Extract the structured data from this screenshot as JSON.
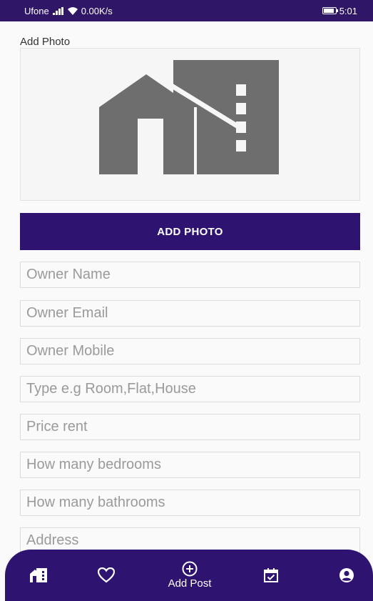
{
  "status_bar": {
    "left_text": "Ufone",
    "network": "0.00K/s",
    "time": "5:01"
  },
  "photo_section": {
    "label": "Add Photo",
    "button_label": "ADD PHOTO",
    "placeholder_icon": "house-icon"
  },
  "form": {
    "owner_name": {
      "value": "",
      "placeholder": "Owner Name"
    },
    "owner_email": {
      "value": "",
      "placeholder": "Owner Email"
    },
    "owner_mobile": {
      "value": "",
      "placeholder": "Owner Mobile"
    },
    "type": {
      "value": "",
      "placeholder": "Type e.g Room,Flat,House"
    },
    "price_rent": {
      "value": "",
      "placeholder": "Price rent"
    },
    "bedrooms": {
      "value": "",
      "placeholder": "How many bedrooms"
    },
    "bathrooms": {
      "value": "",
      "placeholder": "How many bathrooms"
    },
    "address": {
      "value": "",
      "placeholder": "Address"
    }
  },
  "bottom_nav": {
    "items": [
      {
        "icon": "home-icon",
        "label": ""
      },
      {
        "icon": "heart-icon",
        "label": ""
      },
      {
        "icon": "add-circle-icon",
        "label": "Add Post"
      },
      {
        "icon": "calendar-check-icon",
        "label": ""
      },
      {
        "icon": "account-icon",
        "label": ""
      }
    ]
  },
  "colors": {
    "primary": "#2e1470",
    "status_bar": "#2f1667",
    "icon_gray": "#6e6e6e"
  }
}
